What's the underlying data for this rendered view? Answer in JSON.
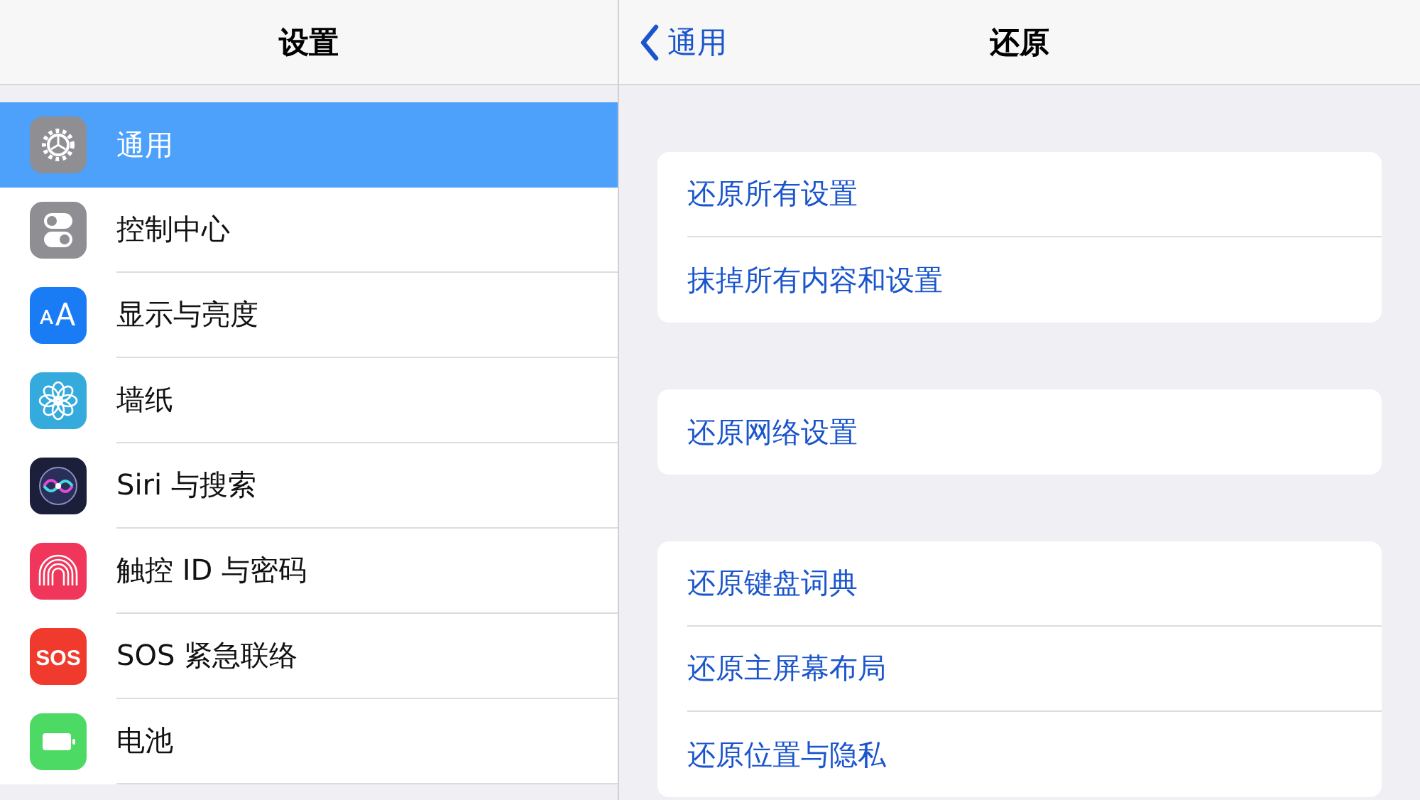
{
  "sidebar": {
    "title": "设置",
    "items": [
      {
        "label": "通用",
        "selected": true
      },
      {
        "label": "控制中心",
        "selected": false
      },
      {
        "label": "显示与亮度",
        "selected": false
      },
      {
        "label": "墙纸",
        "selected": false
      },
      {
        "label": "Siri 与搜索",
        "selected": false
      },
      {
        "label": "触控 ID 与密码",
        "selected": false
      },
      {
        "label": "SOS 紧急联络",
        "selected": false,
        "icon_text": "SOS"
      },
      {
        "label": "电池",
        "selected": false
      }
    ]
  },
  "detail": {
    "back": "通用",
    "title": "还原",
    "groups": [
      [
        "还原所有设置",
        "抹掉所有内容和设置"
      ],
      [
        "还原网络设置"
      ],
      [
        "还原键盘词典",
        "还原主屏幕布局",
        "还原位置与隐私"
      ]
    ]
  }
}
